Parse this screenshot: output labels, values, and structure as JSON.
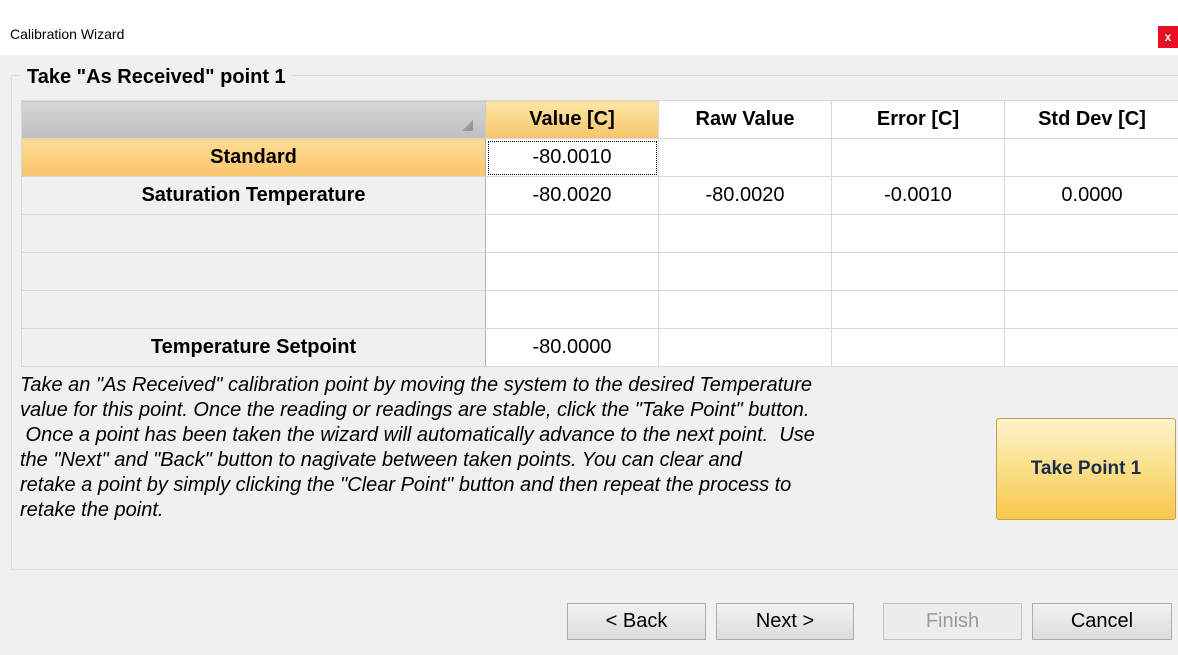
{
  "window": {
    "title": "Calibration Wizard",
    "close_label": "x"
  },
  "group": {
    "label": "Take \"As Received\" point 1"
  },
  "grid": {
    "columns": [
      "Value [C]",
      "Raw Value",
      "Error [C]",
      "Std Dev [C]"
    ],
    "rows": [
      {
        "label": "Standard",
        "cells": [
          "-80.0010",
          "",
          "",
          ""
        ]
      },
      {
        "label": "Saturation Temperature",
        "cells": [
          "-80.0020",
          "-80.0020",
          "-0.0010",
          "0.0000"
        ]
      },
      {
        "label": "",
        "cells": [
          "",
          "",
          "",
          ""
        ]
      },
      {
        "label": "",
        "cells": [
          "",
          "",
          "",
          ""
        ]
      },
      {
        "label": "",
        "cells": [
          "",
          "",
          "",
          ""
        ]
      },
      {
        "label": "Temperature Setpoint",
        "cells": [
          "-80.0000",
          "",
          "",
          ""
        ]
      }
    ]
  },
  "instructions": {
    "lines": [
      "Take an \"As Received\" calibration point by moving the system to the desired Temperature",
      "value for this point.  Once the reading or readings are stable, click the \"Take Point\" button.",
      " Once a point has been taken the wizard will automatically advance to the next point.  Use",
      "the \"Next\" and \"Back\" button to nagivate between taken points.  You can clear and",
      "retake a point by simply clicking the \"Clear Point\" button and then repeat the process to",
      "retake the point."
    ]
  },
  "take_point_button": "Take Point 1",
  "nav": {
    "back": "< Back",
    "next": "Next >",
    "finish": "Finish",
    "cancel": "Cancel"
  }
}
